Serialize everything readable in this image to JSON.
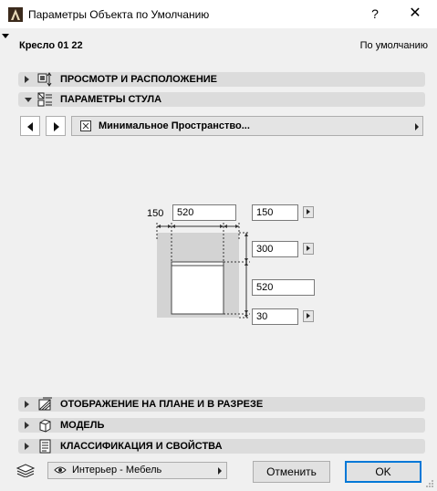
{
  "window": {
    "title": "Параметры Объекта по Умолчанию",
    "help_label": "?",
    "close_label": "✕"
  },
  "object": {
    "name": "Кресло 01 22",
    "default_label": "По умолчанию"
  },
  "panels": {
    "preview": "ПРОСМОТР И РАСПОЛОЖЕНИЕ",
    "chair_params": "ПАРАМЕТРЫ СТУЛА",
    "floor_plan": "ОТОБРАЖЕНИЕ НА ПЛАНЕ И В РАЗРЕЗЕ",
    "model": "МОДЕЛЬ",
    "classification": "КЛАССИФИКАЦИЯ И СВОЙСТВА"
  },
  "page_selector": {
    "label": "Минимальное Пространство..."
  },
  "dimensions": {
    "left_offset_label": "150",
    "width_value": "520",
    "right_offset_value": "150",
    "top_value": "300",
    "depth_value": "520",
    "bottom_value": "30"
  },
  "footer": {
    "favorites_label": "Интерьер - Мебель",
    "cancel_label": "Отменить",
    "ok_label": "OK"
  },
  "colors": {
    "accent": "#0078d7",
    "panel_header": "#dcdcdc",
    "window_bg": "#f0f0f0",
    "clearance_zone": "#d3d3d3"
  }
}
